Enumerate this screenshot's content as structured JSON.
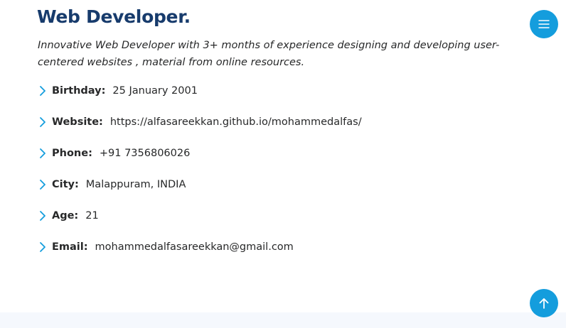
{
  "header": {
    "title": "Web Developer.",
    "intro": "Innovative Web Developer with 3+ months of experience designing and developing user-centered websites , material from online resources."
  },
  "info": [
    {
      "key": "birthday",
      "label": "Birthday:",
      "value": "25 January 2001"
    },
    {
      "key": "website",
      "label": "Website:",
      "value": "https://alfasareekkan.github.io/mohammedalfas/"
    },
    {
      "key": "phone",
      "label": "Phone:",
      "value": "+91 7356806026"
    },
    {
      "key": "city",
      "label": "City:",
      "value": "Malappuram, INDIA"
    },
    {
      "key": "age",
      "label": "Age:",
      "value": "21"
    },
    {
      "key": "email",
      "label": "Email:",
      "value": "mohammedalfasareekkan@gmail.com"
    }
  ],
  "icons": {
    "menu": "menu-icon",
    "back_to_top": "arrow-up-icon",
    "bullet": "chevron-right-icon"
  },
  "colors": {
    "accent": "#149ddd",
    "title": "#173b6c",
    "text": "#272829",
    "footer": "#f5f8fd"
  }
}
